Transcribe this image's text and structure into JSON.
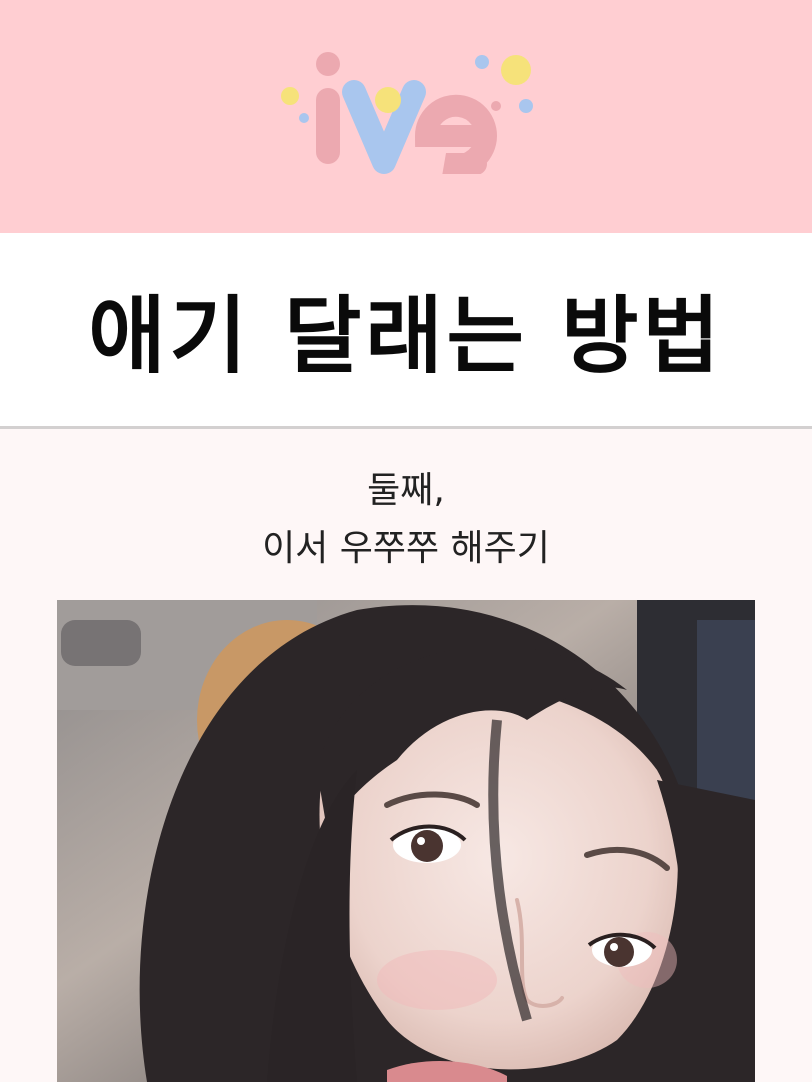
{
  "header": {
    "logo_text": "ive",
    "colors": {
      "background": "#ffced2",
      "logo_pink": "#eca9b0",
      "logo_blue": "#a9c6ee",
      "logo_yellow": "#f6e27a"
    }
  },
  "title": "애기 달래는 방법",
  "subtitle": {
    "line1": "둘째,",
    "line2": "이서 우쭈쭈 해주기"
  },
  "photo": {
    "icon": "photo-of-person"
  }
}
